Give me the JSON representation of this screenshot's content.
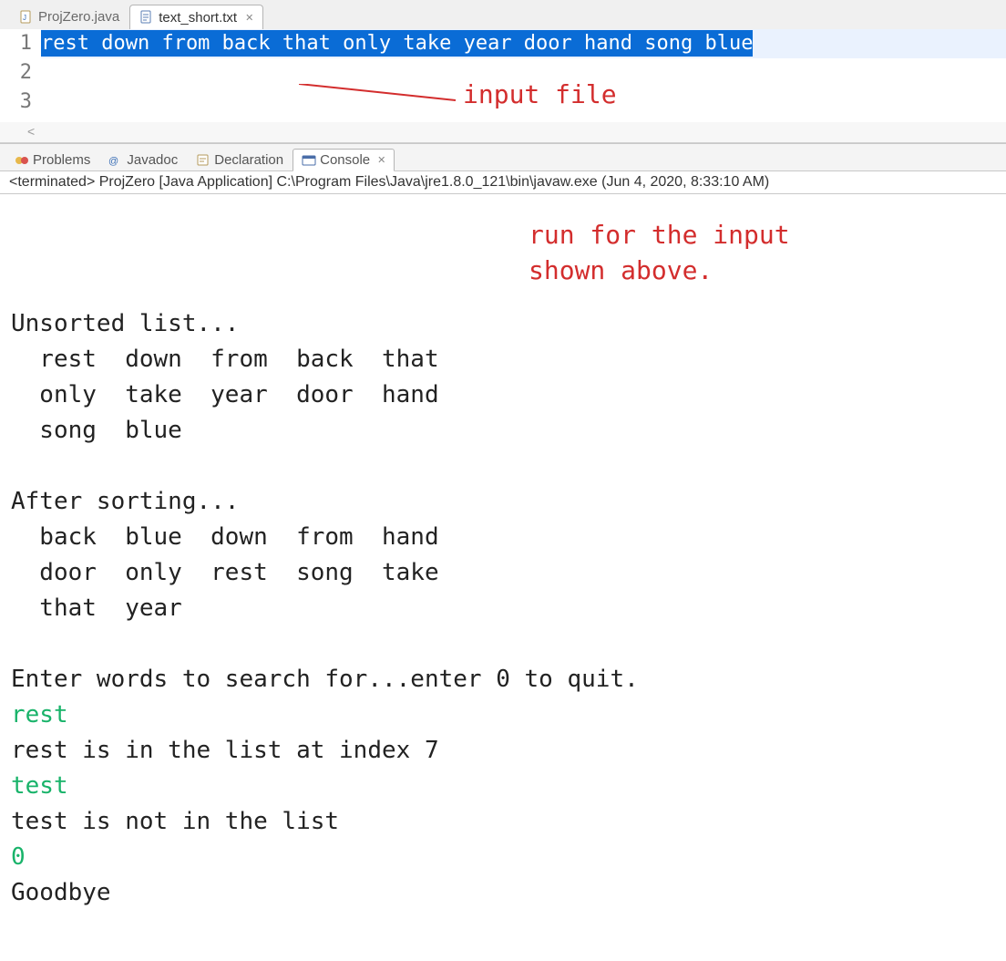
{
  "editor": {
    "tabs": [
      {
        "label": "ProjZero.java",
        "active": false,
        "icon": "java-file-icon"
      },
      {
        "label": "text_short.txt",
        "active": true,
        "icon": "text-file-icon"
      }
    ],
    "line_numbers": [
      "1",
      "2",
      "3"
    ],
    "lines": [
      "rest down from back that only take year door hand song blue",
      "",
      ""
    ],
    "annotation": "input file",
    "scroll_hint": "<"
  },
  "bottom": {
    "tabs": [
      {
        "label": "Problems",
        "icon": "problems-icon",
        "active": false
      },
      {
        "label": "Javadoc",
        "icon": "javadoc-icon",
        "active": false
      },
      {
        "label": "Declaration",
        "icon": "declaration-icon",
        "active": false
      },
      {
        "label": "Console",
        "icon": "console-icon",
        "active": true
      }
    ],
    "console_status": "<terminated> ProjZero [Java Application] C:\\Program Files\\Java\\jre1.8.0_121\\bin\\javaw.exe (Jun 4, 2020, 8:33:10 AM)",
    "annotation": "run for the input\nshown above.",
    "console_segments": [
      {
        "t": "\n",
        "c": "out"
      },
      {
        "t": "Unsorted list...\n",
        "c": "out"
      },
      {
        "t": "  rest  down  from  back  that\n",
        "c": "out"
      },
      {
        "t": "  only  take  year  door  hand\n",
        "c": "out"
      },
      {
        "t": "  song  blue\n",
        "c": "out"
      },
      {
        "t": "\n",
        "c": "out"
      },
      {
        "t": "After sorting...\n",
        "c": "out"
      },
      {
        "t": "  back  blue  down  from  hand\n",
        "c": "out"
      },
      {
        "t": "  door  only  rest  song  take\n",
        "c": "out"
      },
      {
        "t": "  that  year\n",
        "c": "out"
      },
      {
        "t": "\n",
        "c": "out"
      },
      {
        "t": "Enter words to search for...enter 0 to quit.\n",
        "c": "out"
      },
      {
        "t": "rest\n",
        "c": "in"
      },
      {
        "t": "rest is in the list at index 7\n",
        "c": "out"
      },
      {
        "t": "test\n",
        "c": "in"
      },
      {
        "t": "test is not in the list\n",
        "c": "out"
      },
      {
        "t": "0\n",
        "c": "in"
      },
      {
        "t": "Goodbye\n",
        "c": "out"
      }
    ]
  }
}
